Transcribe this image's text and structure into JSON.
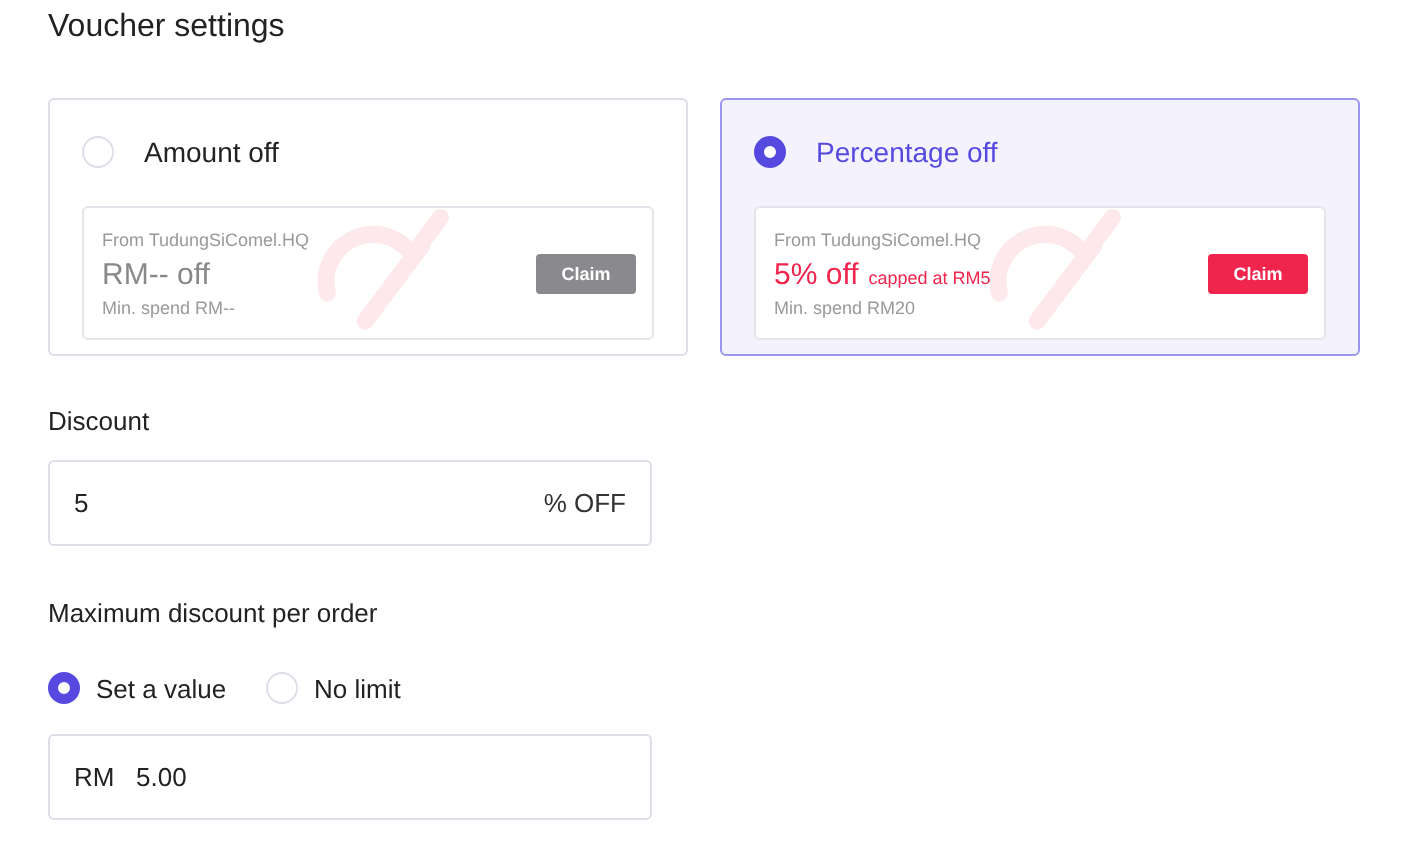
{
  "title": "Voucher settings",
  "voucher_types": [
    {
      "label": "Amount off",
      "selected": false,
      "voucher": {
        "from": "From TudungSiComel.HQ",
        "amount": "RM-- off",
        "min_spend": "Min. spend RM--",
        "claim": "Claim"
      }
    },
    {
      "label": "Percentage off",
      "selected": true,
      "voucher": {
        "from": "From TudungSiComel.HQ",
        "amount": "5% off",
        "cap": "capped at RM5",
        "min_spend": "Min. spend RM20",
        "claim": "Claim"
      }
    }
  ],
  "discount": {
    "label": "Discount",
    "value": "5",
    "suffix": "% OFF"
  },
  "max_discount": {
    "label": "Maximum discount per order",
    "options": [
      {
        "label": "Set a value",
        "selected": true
      },
      {
        "label": "No limit",
        "selected": false
      }
    ],
    "prefix": "RM",
    "value": "5.00"
  }
}
